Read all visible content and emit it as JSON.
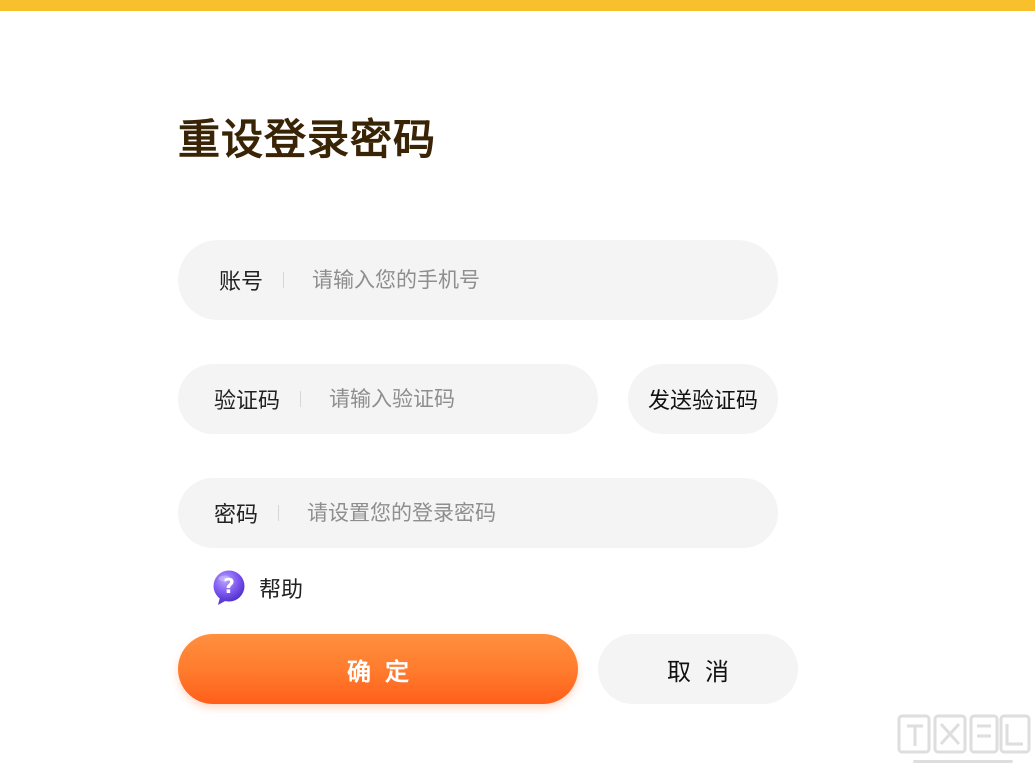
{
  "page": {
    "title": "重设登录密码"
  },
  "form": {
    "account": {
      "label": "账号",
      "placeholder": "请输入您的手机号",
      "value": ""
    },
    "verification_code": {
      "label": "验证码",
      "placeholder": "请输入验证码",
      "value": "",
      "send_button_label": "发送验证码"
    },
    "password": {
      "label": "密码",
      "placeholder": "请设置您的登录密码",
      "value": ""
    }
  },
  "help": {
    "icon": "question-bubble-icon",
    "label": "帮助"
  },
  "actions": {
    "confirm_label": "确定",
    "cancel_label": "取消"
  },
  "colors": {
    "top_bar": "#f9c02d",
    "title_text": "#3a2406",
    "field_background": "#f4f4f4",
    "confirm_gradient_start": "#ff8f3e",
    "confirm_gradient_end": "#ff5e1a",
    "help_icon": "#7d57f0"
  }
}
